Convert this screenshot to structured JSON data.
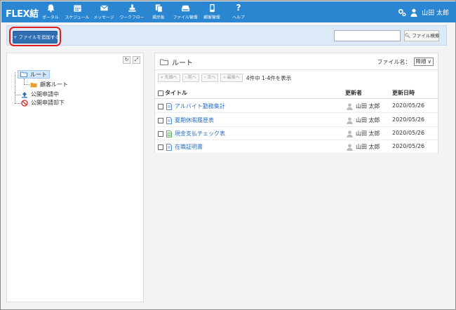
{
  "app": {
    "logo": "FLEX結"
  },
  "nav": [
    {
      "label": "ポータル",
      "icon": "bell-icon"
    },
    {
      "label": "スケジュール",
      "icon": "calendar-icon"
    },
    {
      "label": "メッセージ",
      "icon": "envelope-icon"
    },
    {
      "label": "ワークフロー",
      "icon": "stamp-icon"
    },
    {
      "label": "掲示板",
      "icon": "board-icon"
    },
    {
      "label": "ファイル管理",
      "icon": "drive-icon"
    },
    {
      "label": "顧客管理",
      "icon": "phone-icon"
    },
    {
      "label": "ヘルプ",
      "icon": "question-icon"
    }
  ],
  "user": {
    "name": "山田 太郎"
  },
  "toolbar": {
    "add_file_label": "+ ファイルを追加する",
    "search_placeholder": "",
    "search_button_label": "ファイル検索"
  },
  "tree": {
    "nodes": [
      {
        "label": "ルート",
        "icon": "folder-open-icon",
        "selected": true
      },
      {
        "label": "顧客ルート",
        "icon": "folder-icon",
        "selected": false
      },
      {
        "label": "公開申請中",
        "icon": "upload-icon",
        "selected": false
      },
      {
        "label": "公開申請却下",
        "icon": "forbidden-icon",
        "selected": false
      }
    ]
  },
  "main": {
    "current_folder": "ルート",
    "sort_label": "ファイル名：",
    "sort_value": "降順",
    "pager": {
      "first": "« 先頭へ",
      "prev": "‹ 前へ",
      "next": "› 次へ",
      "last": "» 最後へ",
      "info": "4件中 1-4件を表示"
    },
    "columns": {
      "title": "タイトル",
      "updater": "更新者",
      "updated": "更新日時"
    },
    "rows": [
      {
        "title": "アルバイト勤務集計",
        "updater": "山田 太郎",
        "updated": "2020/05/26",
        "file_icon": "document-icon"
      },
      {
        "title": "夏期休暇履歴表",
        "updater": "山田 太郎",
        "updated": "2020/05/26",
        "file_icon": "document-icon"
      },
      {
        "title": "現金支払チェック表",
        "updater": "山田 太郎",
        "updated": "2020/05/26",
        "file_icon": "spreadsheet-icon"
      },
      {
        "title": "在職証明書",
        "updater": "山田 太郎",
        "updated": "2020/05/26",
        "file_icon": "document-icon"
      }
    ]
  },
  "colors": {
    "header_bg": "#2a86d0",
    "toolbar_bg": "#dce9f6",
    "primary_button": "#2f6db0",
    "highlight": "#e02020",
    "link": "#2a6fbf"
  }
}
